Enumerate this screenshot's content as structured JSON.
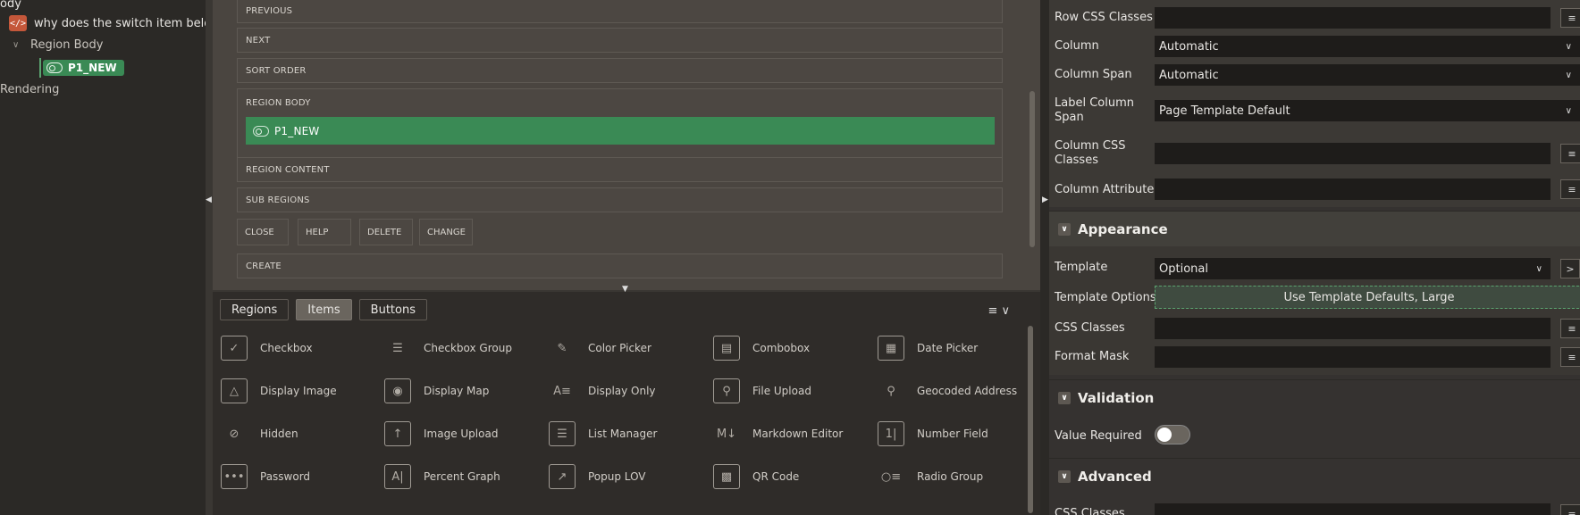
{
  "tree": {
    "row0": "ody",
    "row1": "why does the switch item below hav",
    "row2": "Region Body",
    "row3": "P1_NEW",
    "row4": "Rendering"
  },
  "layout": {
    "slots": [
      "PREVIOUS",
      "NEXT",
      "SORT ORDER"
    ],
    "region_body": "REGION BODY",
    "region_item": "P1_NEW",
    "slots_after": [
      "REGION CONTENT",
      "SUB REGIONS"
    ],
    "buttons": [
      "CLOSE",
      "HELP",
      "DELETE",
      "CHANGE"
    ],
    "create": "CREATE"
  },
  "gallery": {
    "tabs": [
      "Regions",
      "Items",
      "Buttons"
    ],
    "active_tab": "Items",
    "items": [
      [
        "Checkbox",
        "Checkbox Group",
        "Color Picker",
        "Combobox",
        "Date Picker"
      ],
      [
        "Display Image",
        "Display Map",
        "Display Only",
        "File Upload",
        "Geocoded Address"
      ],
      [
        "Hidden",
        "Image Upload",
        "List Manager",
        "Markdown Editor",
        "Number Field"
      ],
      [
        "Password",
        "Percent Graph",
        "Popup LOV",
        "QR Code",
        "Radio Group"
      ]
    ]
  },
  "props": {
    "row_css": "Row CSS Classes",
    "column": "Column",
    "column_value": "Automatic",
    "column_span": "Column Span",
    "column_span_value": "Automatic",
    "label_column_span_1": "Label Column",
    "label_column_span_2": "Span",
    "label_column_span_value": "Page Template Default",
    "column_css_1": "Column CSS",
    "column_css_2": "Classes",
    "column_attributes": "Column Attributes",
    "appearance": "Appearance",
    "template": "Template",
    "template_value": "Optional",
    "template_options": "Template Options",
    "template_options_value": "Use Template Defaults, Large",
    "css_classes": "CSS Classes",
    "format_mask": "Format Mask",
    "validation": "Validation",
    "value_required": "Value Required",
    "advanced": "Advanced",
    "adv_css_classes": "CSS Classes"
  }
}
